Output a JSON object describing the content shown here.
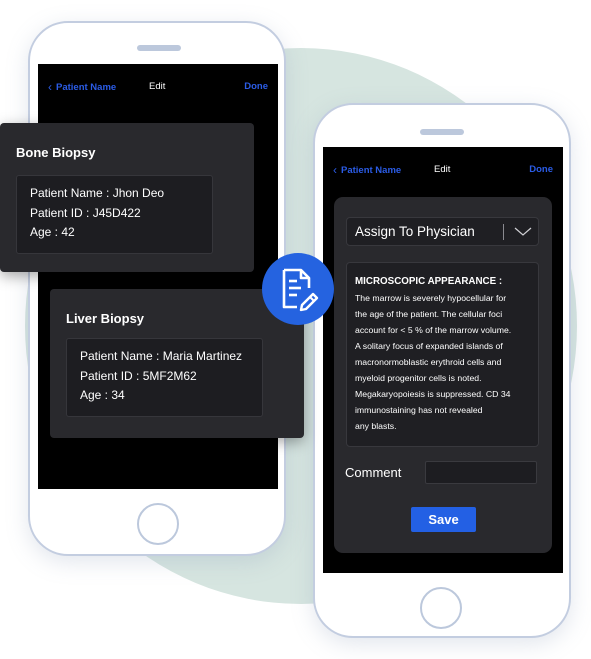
{
  "colors": {
    "accent_blue": "#2563e0",
    "nav_link_blue": "#2b5ce6",
    "screen_bg": "#000000",
    "card_bg": "#29292d",
    "phone_frame": "#c3cde0",
    "background_circle": "#d6e5e0"
  },
  "left_phone": {
    "nav": {
      "back_icon": "chevron-left-icon",
      "back_label": "Patient Name",
      "title": "Edit",
      "done_label": "Done"
    },
    "cards": [
      {
        "title": "Bone Biopsy",
        "lines": [
          "Patient Name : Jhon Deo",
          "Patient ID : J45D422",
          "Age : 42"
        ]
      },
      {
        "title": "Liver Biopsy",
        "lines": [
          "Patient Name : Maria Martinez",
          "Patient ID : 5MF2M62",
          "Age : 34"
        ]
      }
    ]
  },
  "badge": {
    "icon": "document-edit-icon"
  },
  "right_phone": {
    "nav": {
      "back_icon": "chevron-left-icon",
      "back_label": "Patient Name",
      "title": "Edit",
      "done_label": "Done"
    },
    "dropdown": {
      "label": "Assign To Physician",
      "icon": "chevron-down-icon"
    },
    "report": {
      "heading": "MICROSCOPIC APPEARANCE :",
      "lines": [
        "The marrow is severely hypocellular for",
        "the age of the patient. The cellular foci",
        "account for < 5 % of the marrow volume.",
        "A solitary focus of expanded islands of",
        "macronormoblastic erythroid cells and",
        "myeloid progenitor cells is noted.",
        "Megakaryopoiesis is suppressed. CD 34",
        "immunostaining has not revealed",
        "any blasts."
      ]
    },
    "comment": {
      "label": "Comment",
      "value": "",
      "placeholder": ""
    },
    "save_label": "Save"
  }
}
